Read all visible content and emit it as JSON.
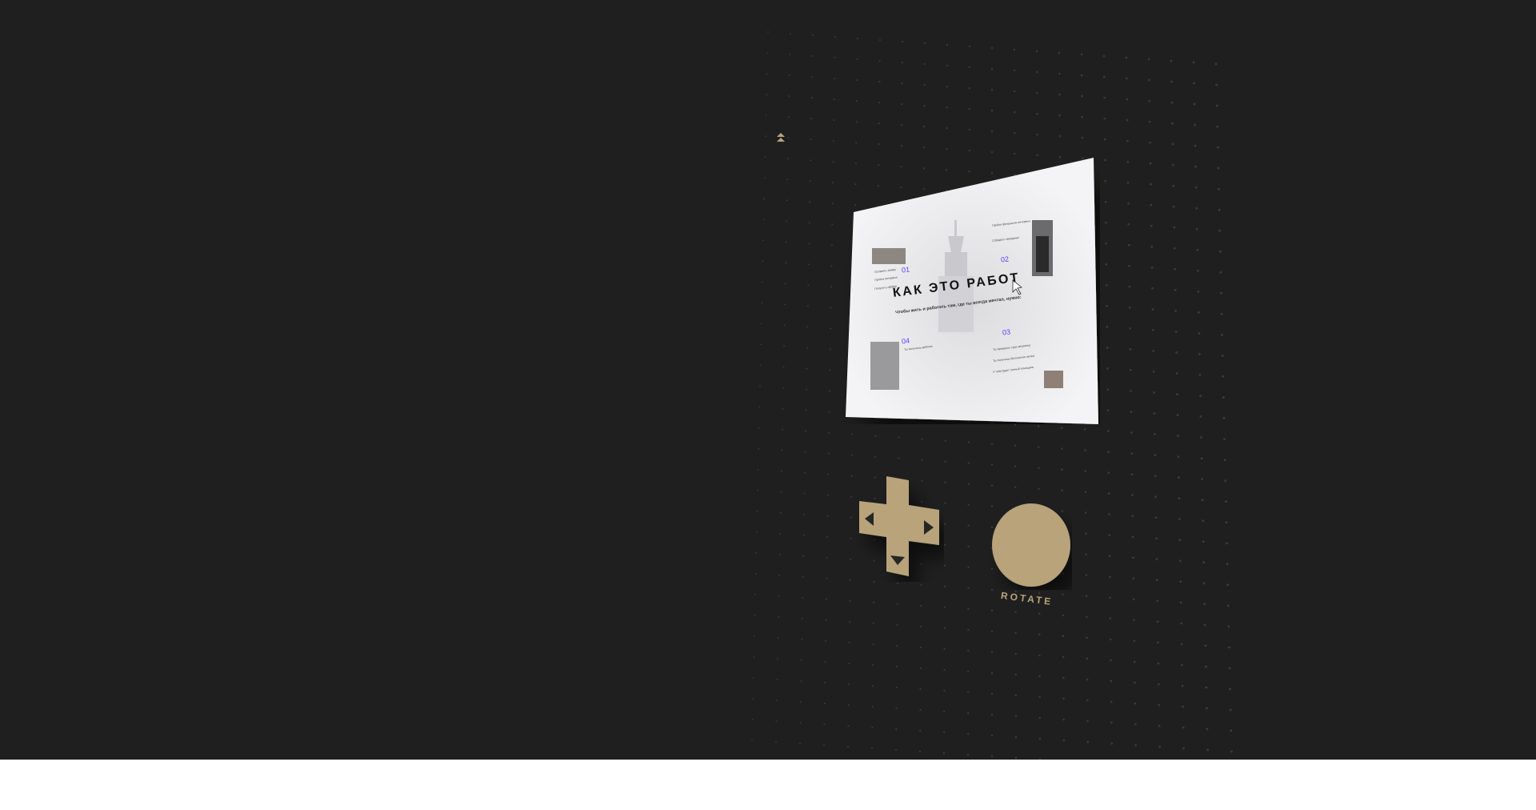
{
  "colors": {
    "background": "#1f1f1f",
    "accent_gold": "#b8a37a",
    "screen": "#f3f3f5",
    "step_number": "#5b3cff"
  },
  "slide": {
    "title": "КАК ЭТО РАБОТ",
    "subtitle": "Чтобы жить и работать там, где ты всегда мечтал, нужно:",
    "steps": [
      {
        "number": "01",
        "lines": [
          "Оставить заявку",
          "Пройти интервью",
          "Получить оффер"
        ]
      },
      {
        "number": "02",
        "lines": [
          "Пройти финальное интервью",
          "Собирать чемоданы!"
        ]
      },
      {
        "number": "03",
        "lines": [
          "Ты приедешь туда заграницу",
          "Ты получишь бесплатное жильё",
          "У тебя будет личный помощник"
        ]
      },
      {
        "number": "04",
        "lines": [
          "Ты получишь рабочее"
        ]
      }
    ]
  },
  "controls": {
    "dpad": "dpad",
    "rotate_label": "ROTATE"
  },
  "icons": [
    "up-arrow-icon",
    "left-arrow-icon",
    "right-arrow-icon",
    "down-arrow-icon",
    "cursor-icon",
    "building-icon",
    "suitcase-icon"
  ]
}
